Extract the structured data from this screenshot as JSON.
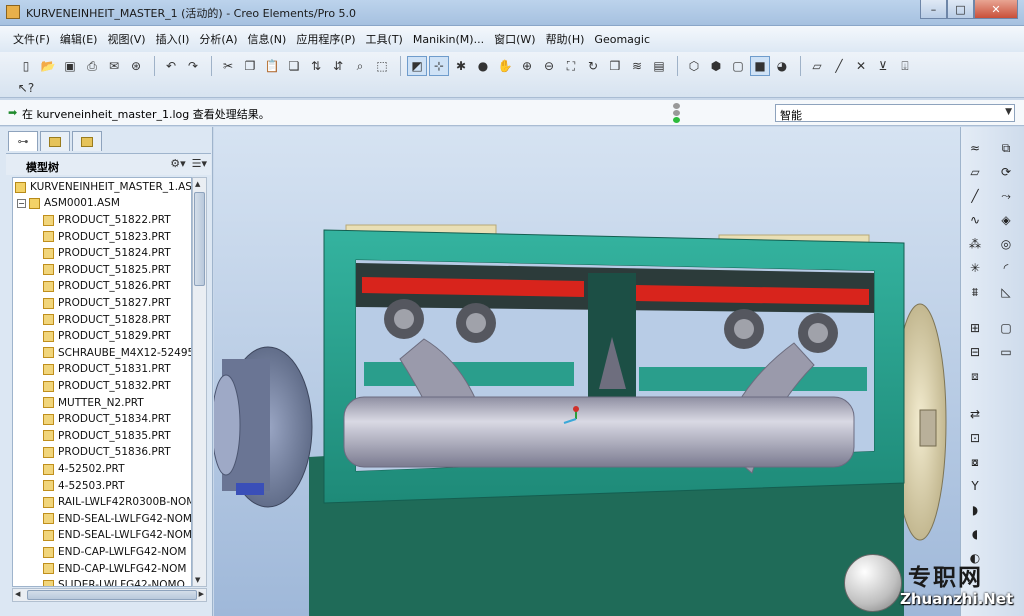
{
  "window": {
    "title": "KURVENEINHEIT_MASTER_1 (活动的) - Creo Elements/Pro 5.0",
    "buttons": {
      "minimize": "–",
      "maximize": "□",
      "close": "✕"
    }
  },
  "menubar": {
    "items": [
      "文件(F)",
      "编辑(E)",
      "视图(V)",
      "插入(I)",
      "分析(A)",
      "信息(N)",
      "应用程序(P)",
      "工具(T)",
      "Manikin(M)...",
      "窗口(W)",
      "帮助(H)",
      "Geomagic"
    ]
  },
  "message": {
    "text": "在 kurveneinheit_master_1.log 查看处理结果。",
    "status_color": "#2dbb3c"
  },
  "selection_filter": {
    "value": "智能"
  },
  "model_tree": {
    "title": "模型树",
    "root": "KURVENEINHEIT_MASTER_1.ASM",
    "sub": "ASM0001.ASM",
    "items": [
      "PRODUCT_51822.PRT",
      "PRODUCT_51823.PRT",
      "PRODUCT_51824.PRT",
      "PRODUCT_51825.PRT",
      "PRODUCT_51826.PRT",
      "PRODUCT_51827.PRT",
      "PRODUCT_51828.PRT",
      "PRODUCT_51829.PRT",
      "SCHRAUBE_M4X12-52495",
      "PRODUCT_51831.PRT",
      "PRODUCT_51832.PRT",
      "MUTTER_N2.PRT",
      "PRODUCT_51834.PRT",
      "PRODUCT_51835.PRT",
      "PRODUCT_51836.PRT",
      "4-52502.PRT",
      "4-52503.PRT",
      "RAIL-LWLF42R0300B-NOM",
      "END-SEAL-LWLFG42-NOM",
      "END-SEAL-LWLFG42-NOM",
      "END-CAP-LWLFG42-NOM",
      "END-CAP-LWLFG42-NOM",
      "SLIDER-LWLFG42-NOMO"
    ]
  },
  "watermark": {
    "cn": "专职网",
    "url": "Zhuanzhi.Net"
  },
  "colors": {
    "frame_teal": "#2a9e8c",
    "housing_dark": "#1f6b58",
    "rail_red": "#d8241c",
    "shaft_gray": "#b9b9c8"
  }
}
